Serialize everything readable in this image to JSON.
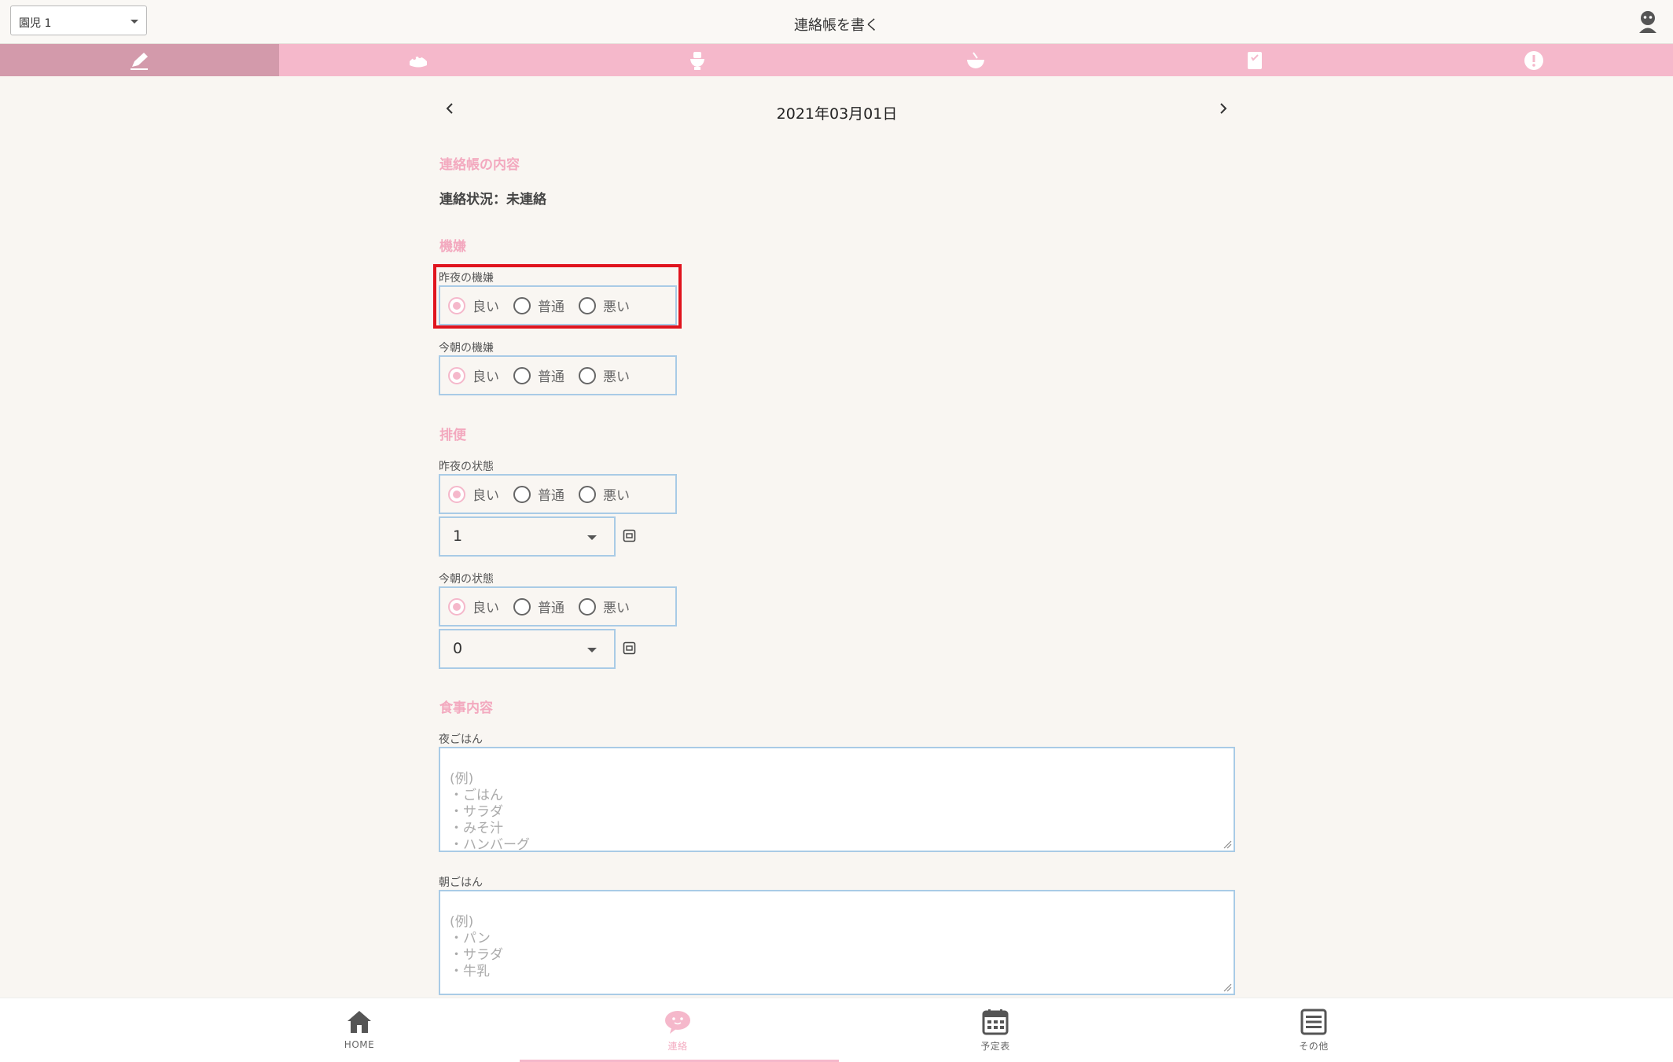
{
  "header": {
    "child_select_value": "園児 1",
    "title": "連絡帳を書く"
  },
  "tabs": [
    {
      "icon": "pencil-icon",
      "active": true
    },
    {
      "icon": "bath-icon"
    },
    {
      "icon": "toilet-icon"
    },
    {
      "icon": "bowl-icon"
    },
    {
      "icon": "calendar-card-icon"
    },
    {
      "icon": "alert-icon"
    }
  ],
  "date_nav": {
    "date": "2021年03月01日"
  },
  "content": {
    "section_contact": "連絡帳の内容",
    "contact_status": "連絡状況：未連絡",
    "section_mood": "機嫌",
    "mood_last_night_label": "昨夜の機嫌",
    "mood_this_morning_label": "今朝の機嫌",
    "section_excretion": "排便",
    "stool_last_night_label": "昨夜の状態",
    "stool_last_night_count": "1",
    "stool_this_morning_label": "今朝の状態",
    "stool_this_morning_count": "0",
    "section_meal": "食事内容",
    "dinner_label": "夜ごはん",
    "dinner_placeholder": "(例)\n・ごはん\n・サラダ\n・みそ汁\n・ハンバーグ",
    "breakfast_label": "朝ごはん",
    "breakfast_placeholder": "(例)\n・パン\n・サラダ\n・牛乳"
  },
  "radio_options": {
    "good": "良い",
    "normal": "普通",
    "bad": "悪い"
  },
  "bottom_nav": {
    "home": "HOME",
    "contact": "連絡",
    "schedule": "予定表",
    "other": "その他"
  },
  "colors": {
    "accent_pink": "#f5b8cb",
    "active_tab": "#d39aab",
    "field_border": "#a9cbe6",
    "highlight_red": "#e0141e"
  }
}
